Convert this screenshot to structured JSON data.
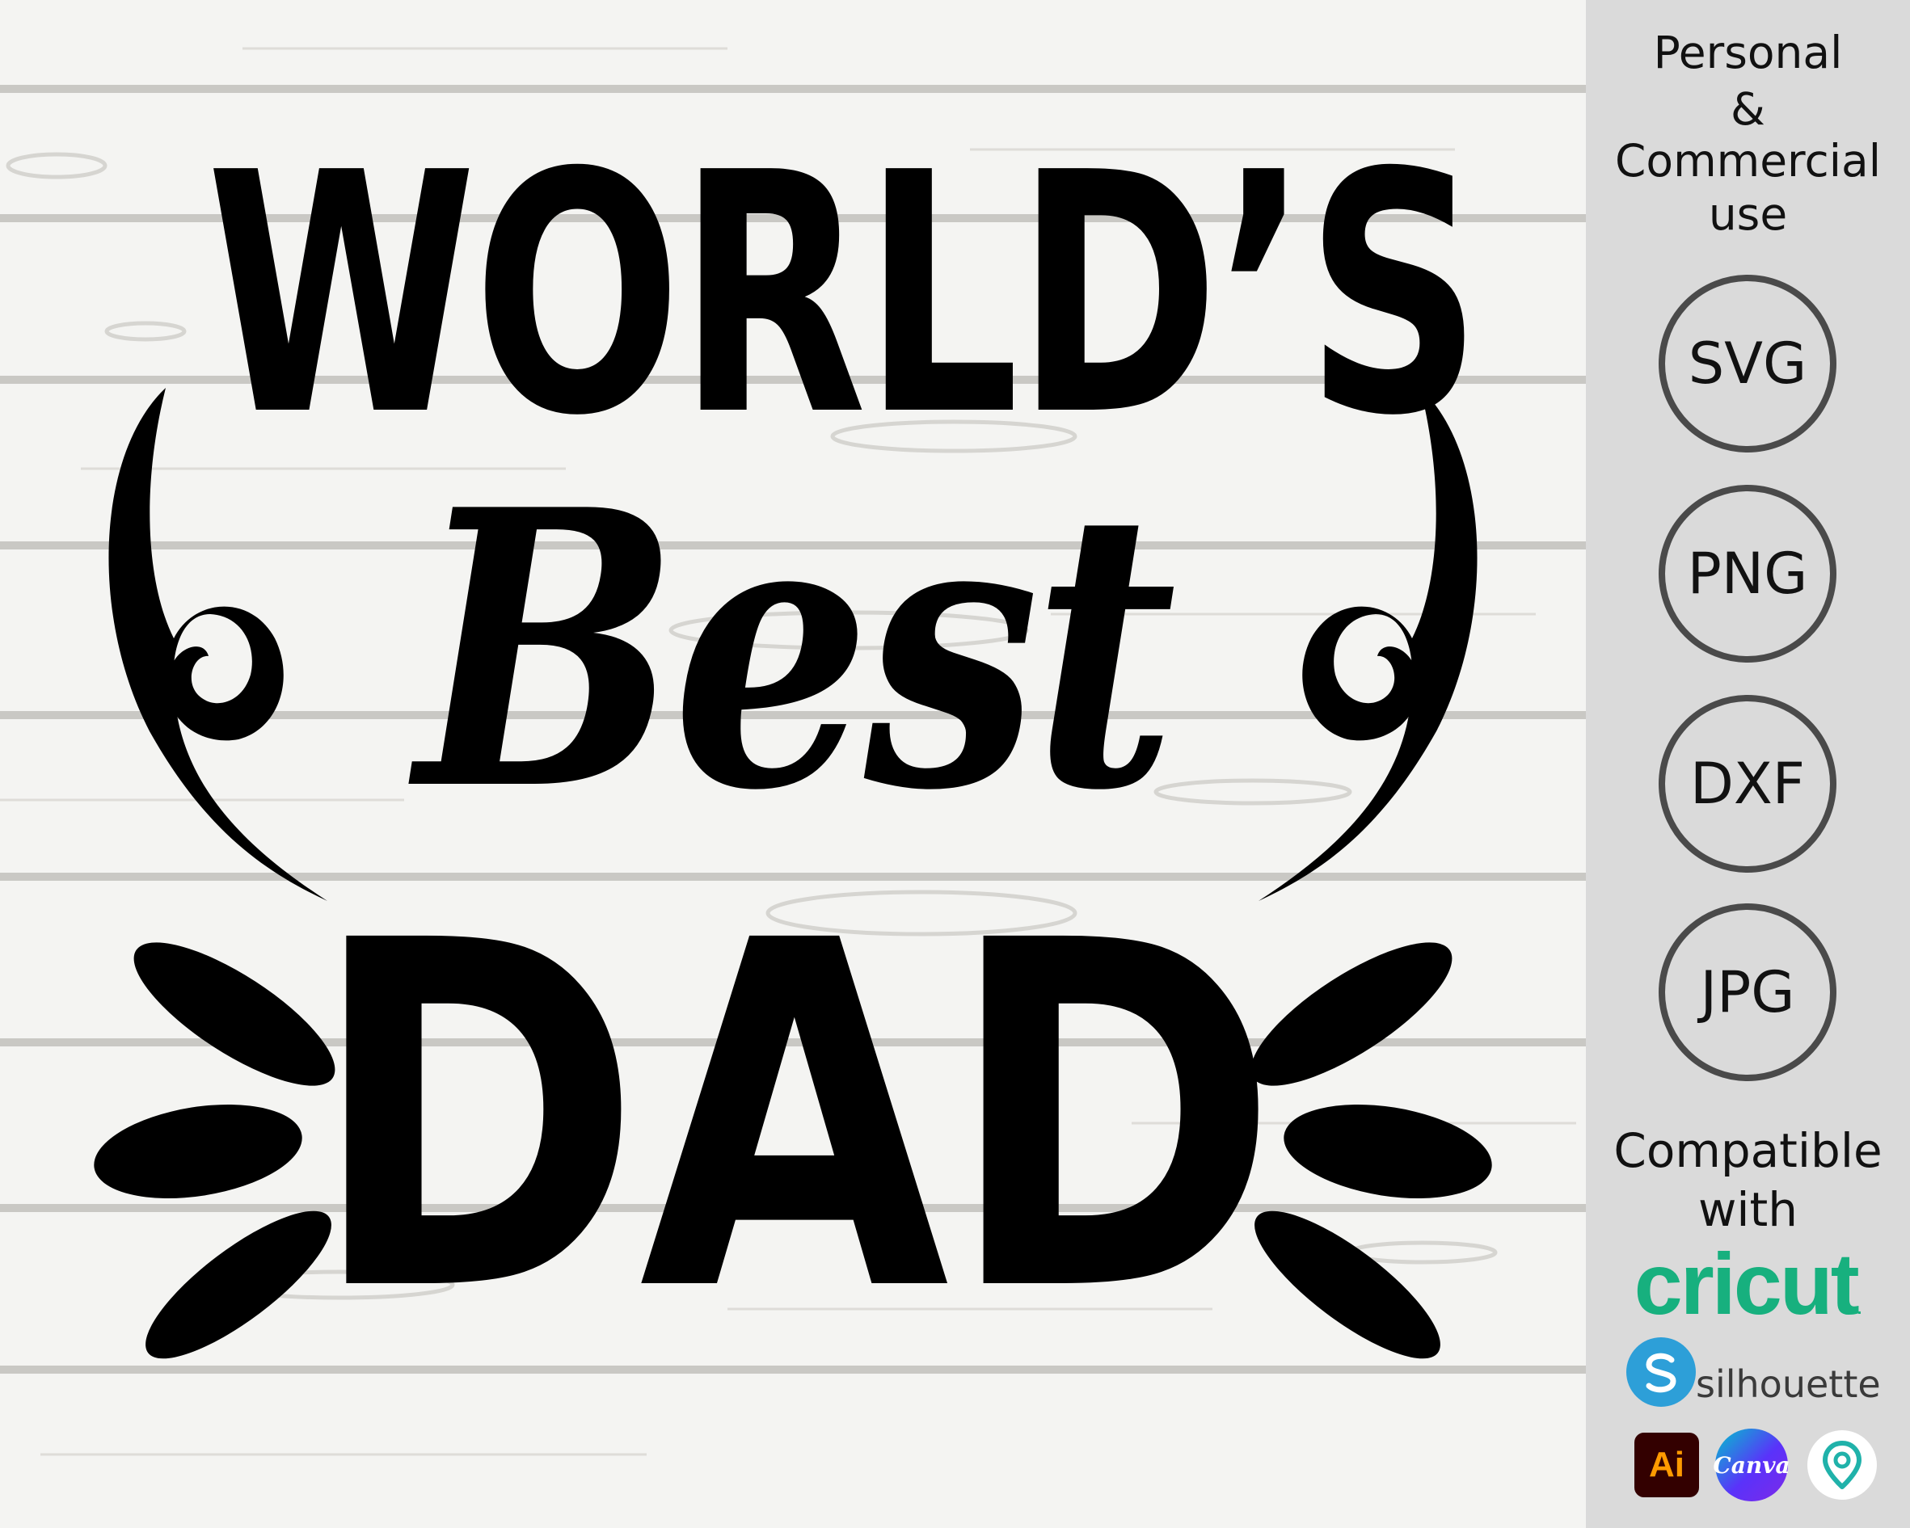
{
  "design": {
    "line1": "WORLD’S",
    "line2": "Best",
    "line3": "DAD"
  },
  "sidebar": {
    "usage": [
      "Personal",
      "&",
      "Commercial",
      "use"
    ],
    "formats": [
      "SVG",
      "PNG",
      "DXF",
      "JPG"
    ],
    "compatible": [
      "Compatible",
      "with"
    ],
    "cricut_label": "cricut",
    "silhouette_label": "silhouette",
    "ai_label": "Ai",
    "canva_label": "Canva"
  },
  "colors": {
    "background_wood": "#f4f4f2",
    "sidebar": "#dadada",
    "badge_border": "#4a4a4a",
    "cricut_green": "#17b07e",
    "silhouette_blue": "#2d9fd8",
    "ai_orange": "#ff9a00",
    "ai_dark": "#330000"
  },
  "icons": {
    "silhouette": "silhouette-s-icon",
    "ai": "adobe-illustrator-icon",
    "canva": "canva-icon",
    "third": "map-pin-location-icon"
  }
}
